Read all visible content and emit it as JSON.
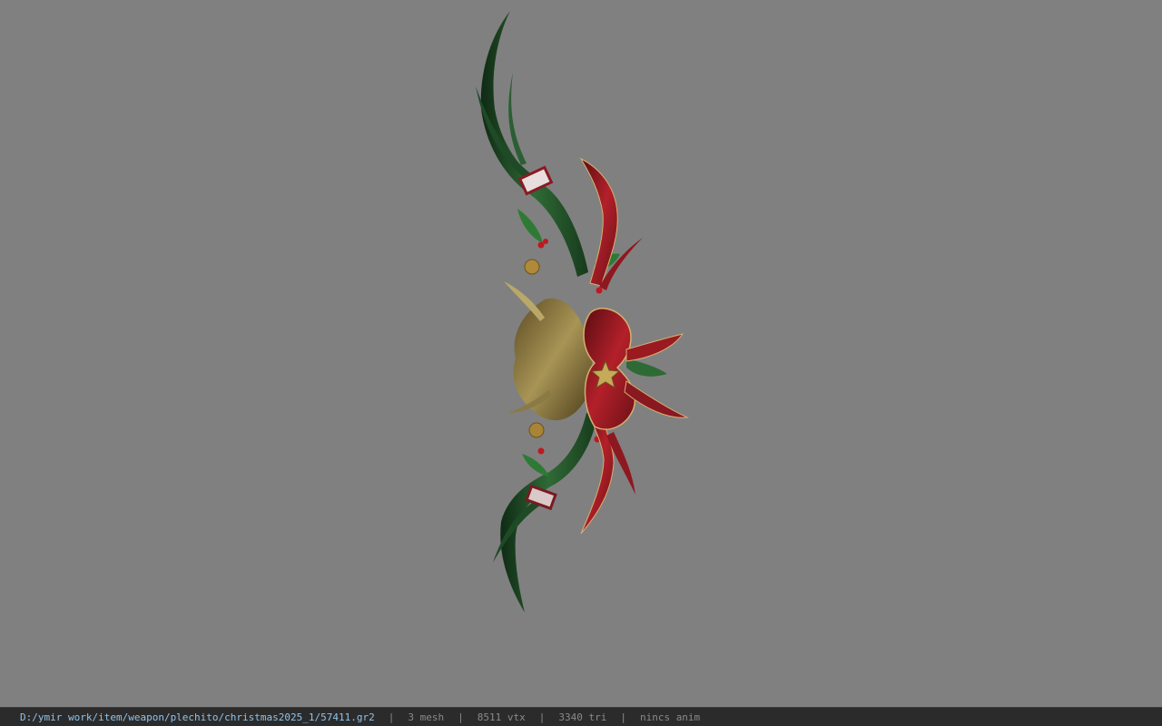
{
  "viewport": {
    "background": "#808080",
    "model_name": "christmas bow weapon model"
  },
  "statusbar": {
    "path": "D:/ymir work/item/weapon/plechito/christmas2025_1/57411.gr2",
    "separator": "|",
    "mesh": "3 mesh",
    "vtx": "8511 vtx",
    "tri": "3340 tri",
    "anim": "nincs anim",
    "path_color": "#8fc3ea",
    "text_color": "#8a8a8a",
    "background": "#2b2b2b"
  }
}
